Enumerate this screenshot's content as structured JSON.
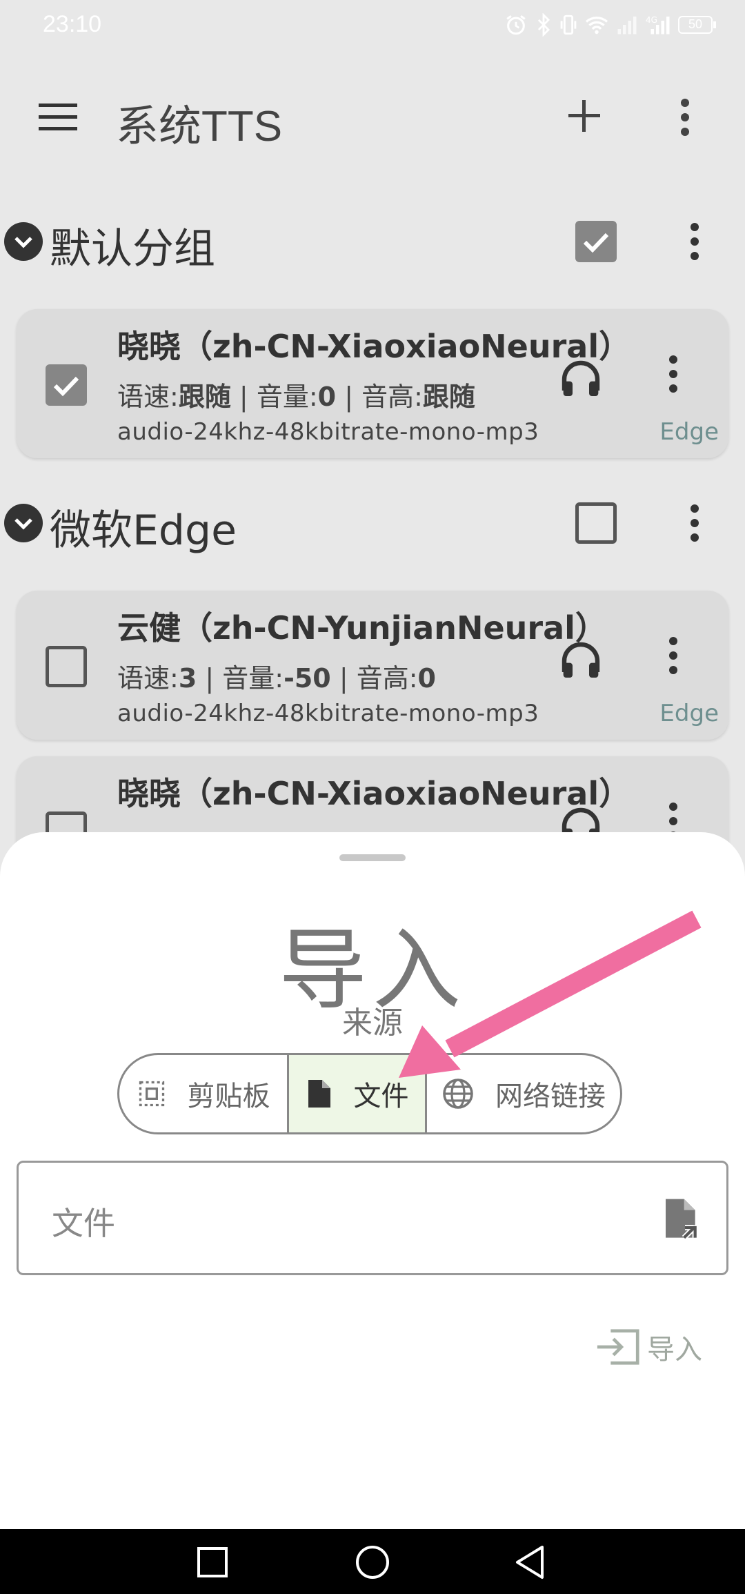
{
  "status_bar": {
    "time": "23:10",
    "battery": "50",
    "icons": [
      "alarm-icon",
      "bluetooth-icon",
      "vibrate-icon",
      "wifi-icon",
      "signal-icon",
      "signal-4g-icon",
      "battery-icon"
    ]
  },
  "app_bar": {
    "title": "系统TTS",
    "icons": [
      "menu-icon",
      "add-icon",
      "more-vert-icon"
    ]
  },
  "groups": [
    {
      "title": "默认分组",
      "checked": true,
      "items": [
        {
          "name": "晓晓（zh-CN-XiaoxiaoNeural）",
          "speed_label": "语速:",
          "speed_value": "跟随",
          "volume_label": "音量:",
          "volume_value": "0",
          "pitch_label": "音高:",
          "pitch_value": "跟随",
          "format": "audio-24khz-48kbitrate-mono-mp3",
          "engine": "Edge",
          "checked": true
        }
      ]
    },
    {
      "title": "微软Edge",
      "checked": false,
      "items": [
        {
          "name": "云健（zh-CN-YunjianNeural）",
          "speed_label": "语速:",
          "speed_value": "3",
          "volume_label": "音量:",
          "volume_value": "-50",
          "pitch_label": "音高:",
          "pitch_value": "0",
          "format": "audio-24khz-48kbitrate-mono-mp3",
          "engine": "Edge",
          "checked": false
        },
        {
          "name": "晓晓（zh-CN-XiaoxiaoNeural）",
          "checked": false
        }
      ]
    }
  ],
  "separator": "|",
  "sheet": {
    "title": "导入",
    "subtitle": "来源",
    "sources": [
      {
        "label": "剪贴板",
        "icon": "clipboard-icon",
        "selected": false
      },
      {
        "label": "文件",
        "icon": "file-icon",
        "selected": true
      },
      {
        "label": "网络链接",
        "icon": "globe-icon",
        "selected": false
      }
    ],
    "file_field": {
      "placeholder": "文件",
      "icon": "file-open-icon"
    },
    "import_button": {
      "label": "导入",
      "icon": "import-icon"
    }
  },
  "colors": {
    "annotation_arrow": "#f06ea0",
    "selected_segment": "#eef7e6",
    "engine_text": "#6e8f8f"
  }
}
